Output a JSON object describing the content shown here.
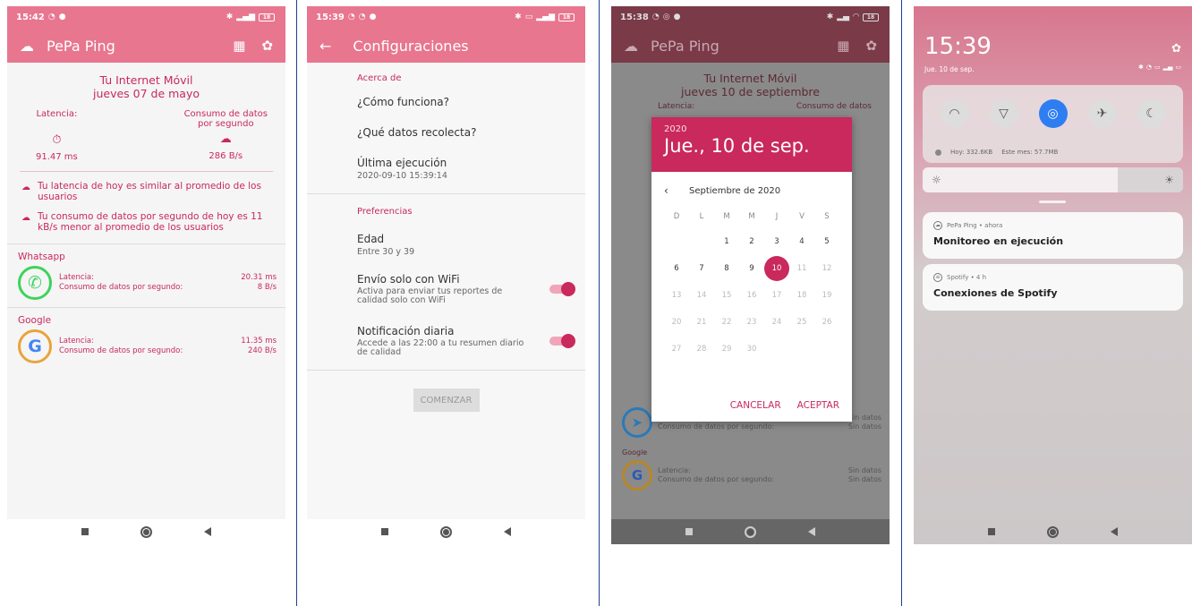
{
  "phone1": {
    "status_time": "15:42",
    "status_battery": "18",
    "app_title": "PePa Ping",
    "heading": "Tu Internet Móvil",
    "date": "jueves 07 de mayo",
    "latency_label": "Latencia:",
    "consumption_label_1": "Consumo de datos",
    "consumption_label_2": "por segundo",
    "latency_value": "91.47 ms",
    "consumption_value": "286 B/s",
    "notice1": "Tu latencia de hoy es similar al promedio de los usuarios",
    "notice2": "Tu consumo de datos por segundo de hoy es 11 kB/s menor al promedio de los usuarios",
    "apps": [
      {
        "name": "Whatsapp",
        "latency_label": "Latencia:",
        "consumption_label": "Consumo de datos por segundo:",
        "latency": "20.31 ms",
        "consumption": "8 B/s"
      },
      {
        "name": "Google",
        "latency_label": "Latencia:",
        "consumption_label": "Consumo de datos por segundo:",
        "latency": "11.35 ms",
        "consumption": "240 B/s"
      }
    ]
  },
  "phone2": {
    "status_time": "15:39",
    "status_battery": "18",
    "app_title": "Configuraciones",
    "section_about": "Acerca de",
    "how_it_works": "¿Cómo funciona?",
    "what_data": "¿Qué datos recolecta?",
    "last_run_label": "Última ejecución",
    "last_run_value": "2020-09-10 15:39:14",
    "section_prefs": "Preferencias",
    "age_label": "Edad",
    "age_value": "Entre 30 y 39",
    "wifi_label": "Envío solo con WiFi",
    "wifi_sub": "Activa para enviar tus reportes de calidad solo con WiFi",
    "daily_label": "Notificación diaria",
    "daily_sub": "Accede a las 22:00 a tu resumen diario de calidad",
    "start_button": "COMENZAR"
  },
  "phone3": {
    "status_time": "15:38",
    "status_battery": "18",
    "app_title": "PePa Ping",
    "heading": "Tu Internet Móvil",
    "date": "jueves 10 de septiembre",
    "latency_label": "Latencia:",
    "consumption_label": "Consumo de datos",
    "bg_latency_label": "Latencia:",
    "bg_consumption_label": "Consumo de datos por segundo:",
    "bg_value": "Sin datos",
    "bg_google": "Google",
    "dialog_year": "2020",
    "dialog_date": "Jue., 10 de sep.",
    "month_label": "Septiembre de 2020",
    "weekdays": [
      "D",
      "L",
      "M",
      "M",
      "J",
      "V",
      "S"
    ],
    "cancel": "CANCELAR",
    "accept": "ACEPTAR"
  },
  "phone4": {
    "time": "15:39",
    "date": "Jue. 10 de sep.",
    "data_today": "Hoy: 332.6KB",
    "data_month": "Este mes: 57.7MB",
    "notif1_app": "PePa Ping • ahora",
    "notif1_text": "Monitoreo en ejecución",
    "notif2_app": "Spotify • 4 h",
    "notif2_text": "Conexiones de Spotify"
  },
  "colors": {
    "accent": "#c9295c",
    "appbar": "#e8768f",
    "toggle_on": "#c9295c"
  }
}
